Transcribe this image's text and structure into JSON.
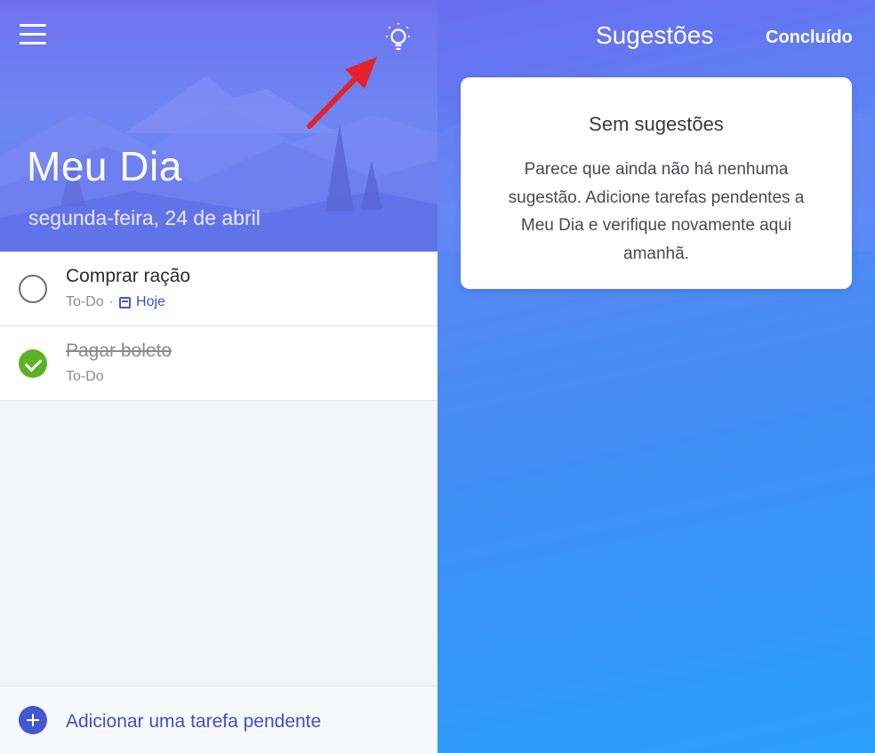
{
  "my_day": {
    "title": "Meu Dia",
    "date": "segunda-feira, 24 de abril",
    "tasks": [
      {
        "title": "Comprar ração",
        "list": "To-Do",
        "due": "Hoje",
        "completed": false
      },
      {
        "title": "Pagar boleto",
        "list": "To-Do",
        "completed": true
      }
    ],
    "add_task_label": "Adicionar uma tarefa pendente"
  },
  "suggestions": {
    "title": "Sugestões",
    "done_label": "Concluído",
    "card": {
      "title": "Sem sugestões",
      "body": "Parece que ainda não há nenhuma sugestão. Adicione tarefas pendentes a Meu Dia e verifique novamente aqui amanhã."
    }
  },
  "icons": {
    "menu": "hamburger-menu-icon",
    "suggestions": "lightbulb-icon",
    "annotation": "red-arrow",
    "add": "plus-circle-icon",
    "due_date": "calendar-icon"
  },
  "colors": {
    "accent": "#4457d3",
    "complete": "#5db124",
    "arrow": "#e3222a"
  }
}
